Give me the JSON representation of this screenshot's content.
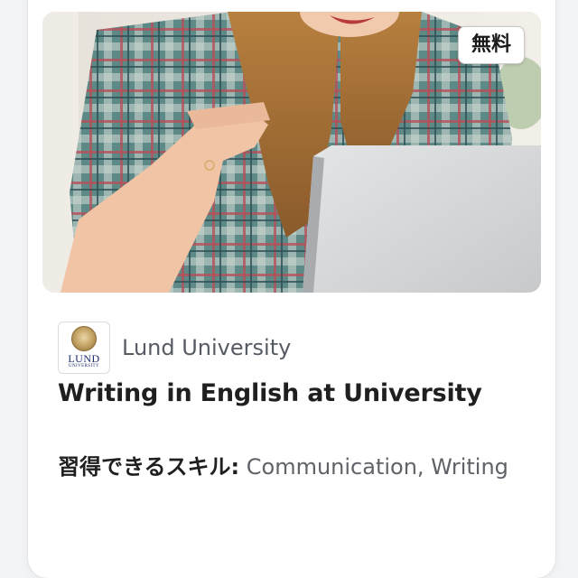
{
  "badge": {
    "label": "無料"
  },
  "partner": {
    "name": "Lund University",
    "logo_word": "LUND",
    "logo_sub": "UNIVERSITY"
  },
  "course": {
    "title": "Writing in English at University"
  },
  "skills": {
    "label": "習得できるスキル:",
    "value": " Communication, Writing"
  },
  "colors": {
    "title": "#1f1f1f",
    "muted": "#5f6368",
    "logo_blue": "#1b2a6b"
  },
  "image": {
    "subject": "woman-in-plaid-shirt-with-laptop"
  }
}
